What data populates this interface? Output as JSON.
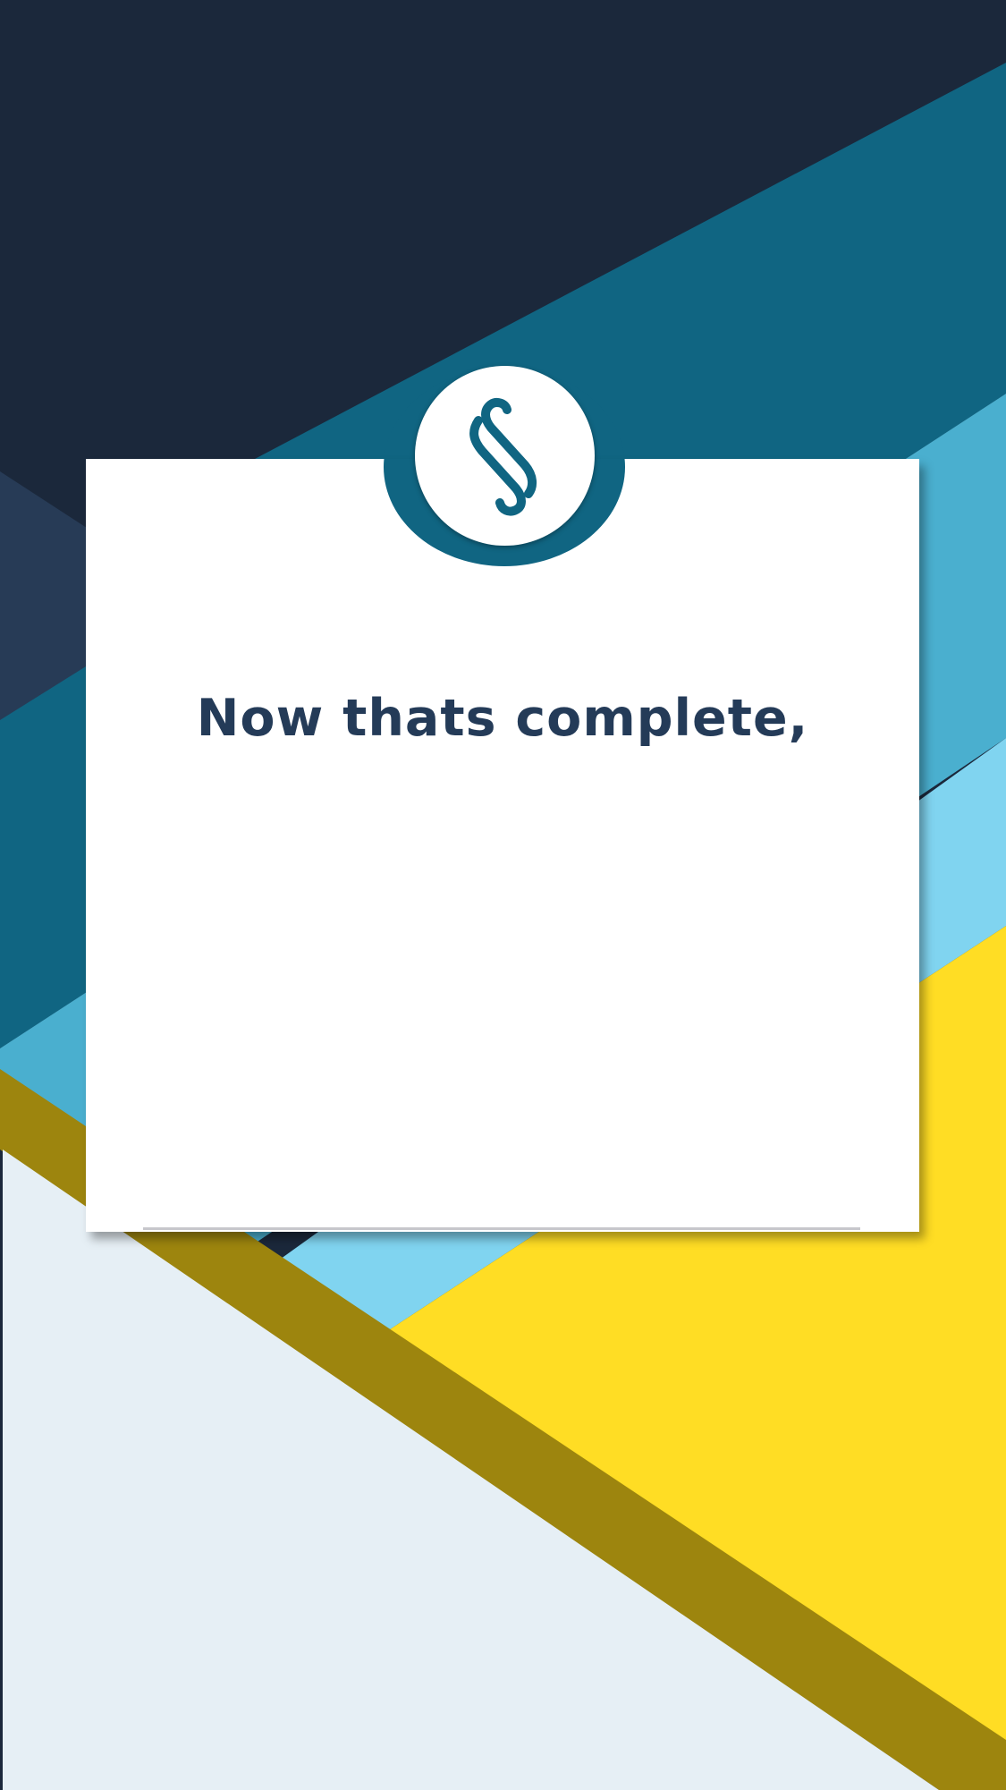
{
  "colors": {
    "navy": "#1b283b",
    "slate": "#273b56",
    "teal": "#106582",
    "mid_blue": "#4aafcf",
    "light_blue": "#80d4f0",
    "yellow": "#ffdd24",
    "olive": "#9d850e",
    "pale": "#e6eff5",
    "text": "#243b58",
    "card": "#ffffff"
  },
  "logo": {
    "icon": "section-sign-icon"
  },
  "card": {
    "headline": "Now thats complete,"
  }
}
